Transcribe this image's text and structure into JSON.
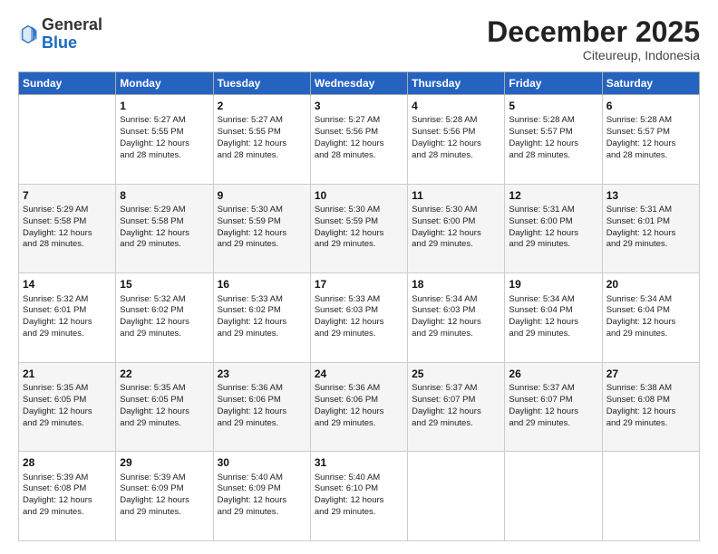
{
  "logo": {
    "general": "General",
    "blue": "Blue"
  },
  "title": "December 2025",
  "subtitle": "Citeureup, Indonesia",
  "days": [
    "Sunday",
    "Monday",
    "Tuesday",
    "Wednesday",
    "Thursday",
    "Friday",
    "Saturday"
  ],
  "weeks": [
    [
      {
        "num": "",
        "lines": []
      },
      {
        "num": "1",
        "lines": [
          "Sunrise: 5:27 AM",
          "Sunset: 5:55 PM",
          "Daylight: 12 hours",
          "and 28 minutes."
        ]
      },
      {
        "num": "2",
        "lines": [
          "Sunrise: 5:27 AM",
          "Sunset: 5:55 PM",
          "Daylight: 12 hours",
          "and 28 minutes."
        ]
      },
      {
        "num": "3",
        "lines": [
          "Sunrise: 5:27 AM",
          "Sunset: 5:56 PM",
          "Daylight: 12 hours",
          "and 28 minutes."
        ]
      },
      {
        "num": "4",
        "lines": [
          "Sunrise: 5:28 AM",
          "Sunset: 5:56 PM",
          "Daylight: 12 hours",
          "and 28 minutes."
        ]
      },
      {
        "num": "5",
        "lines": [
          "Sunrise: 5:28 AM",
          "Sunset: 5:57 PM",
          "Daylight: 12 hours",
          "and 28 minutes."
        ]
      },
      {
        "num": "6",
        "lines": [
          "Sunrise: 5:28 AM",
          "Sunset: 5:57 PM",
          "Daylight: 12 hours",
          "and 28 minutes."
        ]
      }
    ],
    [
      {
        "num": "7",
        "lines": [
          "Sunrise: 5:29 AM",
          "Sunset: 5:58 PM",
          "Daylight: 12 hours",
          "and 28 minutes."
        ]
      },
      {
        "num": "8",
        "lines": [
          "Sunrise: 5:29 AM",
          "Sunset: 5:58 PM",
          "Daylight: 12 hours",
          "and 29 minutes."
        ]
      },
      {
        "num": "9",
        "lines": [
          "Sunrise: 5:30 AM",
          "Sunset: 5:59 PM",
          "Daylight: 12 hours",
          "and 29 minutes."
        ]
      },
      {
        "num": "10",
        "lines": [
          "Sunrise: 5:30 AM",
          "Sunset: 5:59 PM",
          "Daylight: 12 hours",
          "and 29 minutes."
        ]
      },
      {
        "num": "11",
        "lines": [
          "Sunrise: 5:30 AM",
          "Sunset: 6:00 PM",
          "Daylight: 12 hours",
          "and 29 minutes."
        ]
      },
      {
        "num": "12",
        "lines": [
          "Sunrise: 5:31 AM",
          "Sunset: 6:00 PM",
          "Daylight: 12 hours",
          "and 29 minutes."
        ]
      },
      {
        "num": "13",
        "lines": [
          "Sunrise: 5:31 AM",
          "Sunset: 6:01 PM",
          "Daylight: 12 hours",
          "and 29 minutes."
        ]
      }
    ],
    [
      {
        "num": "14",
        "lines": [
          "Sunrise: 5:32 AM",
          "Sunset: 6:01 PM",
          "Daylight: 12 hours",
          "and 29 minutes."
        ]
      },
      {
        "num": "15",
        "lines": [
          "Sunrise: 5:32 AM",
          "Sunset: 6:02 PM",
          "Daylight: 12 hours",
          "and 29 minutes."
        ]
      },
      {
        "num": "16",
        "lines": [
          "Sunrise: 5:33 AM",
          "Sunset: 6:02 PM",
          "Daylight: 12 hours",
          "and 29 minutes."
        ]
      },
      {
        "num": "17",
        "lines": [
          "Sunrise: 5:33 AM",
          "Sunset: 6:03 PM",
          "Daylight: 12 hours",
          "and 29 minutes."
        ]
      },
      {
        "num": "18",
        "lines": [
          "Sunrise: 5:34 AM",
          "Sunset: 6:03 PM",
          "Daylight: 12 hours",
          "and 29 minutes."
        ]
      },
      {
        "num": "19",
        "lines": [
          "Sunrise: 5:34 AM",
          "Sunset: 6:04 PM",
          "Daylight: 12 hours",
          "and 29 minutes."
        ]
      },
      {
        "num": "20",
        "lines": [
          "Sunrise: 5:34 AM",
          "Sunset: 6:04 PM",
          "Daylight: 12 hours",
          "and 29 minutes."
        ]
      }
    ],
    [
      {
        "num": "21",
        "lines": [
          "Sunrise: 5:35 AM",
          "Sunset: 6:05 PM",
          "Daylight: 12 hours",
          "and 29 minutes."
        ]
      },
      {
        "num": "22",
        "lines": [
          "Sunrise: 5:35 AM",
          "Sunset: 6:05 PM",
          "Daylight: 12 hours",
          "and 29 minutes."
        ]
      },
      {
        "num": "23",
        "lines": [
          "Sunrise: 5:36 AM",
          "Sunset: 6:06 PM",
          "Daylight: 12 hours",
          "and 29 minutes."
        ]
      },
      {
        "num": "24",
        "lines": [
          "Sunrise: 5:36 AM",
          "Sunset: 6:06 PM",
          "Daylight: 12 hours",
          "and 29 minutes."
        ]
      },
      {
        "num": "25",
        "lines": [
          "Sunrise: 5:37 AM",
          "Sunset: 6:07 PM",
          "Daylight: 12 hours",
          "and 29 minutes."
        ]
      },
      {
        "num": "26",
        "lines": [
          "Sunrise: 5:37 AM",
          "Sunset: 6:07 PM",
          "Daylight: 12 hours",
          "and 29 minutes."
        ]
      },
      {
        "num": "27",
        "lines": [
          "Sunrise: 5:38 AM",
          "Sunset: 6:08 PM",
          "Daylight: 12 hours",
          "and 29 minutes."
        ]
      }
    ],
    [
      {
        "num": "28",
        "lines": [
          "Sunrise: 5:39 AM",
          "Sunset: 6:08 PM",
          "Daylight: 12 hours",
          "and 29 minutes."
        ]
      },
      {
        "num": "29",
        "lines": [
          "Sunrise: 5:39 AM",
          "Sunset: 6:09 PM",
          "Daylight: 12 hours",
          "and 29 minutes."
        ]
      },
      {
        "num": "30",
        "lines": [
          "Sunrise: 5:40 AM",
          "Sunset: 6:09 PM",
          "Daylight: 12 hours",
          "and 29 minutes."
        ]
      },
      {
        "num": "31",
        "lines": [
          "Sunrise: 5:40 AM",
          "Sunset: 6:10 PM",
          "Daylight: 12 hours",
          "and 29 minutes."
        ]
      },
      {
        "num": "",
        "lines": []
      },
      {
        "num": "",
        "lines": []
      },
      {
        "num": "",
        "lines": []
      }
    ]
  ]
}
